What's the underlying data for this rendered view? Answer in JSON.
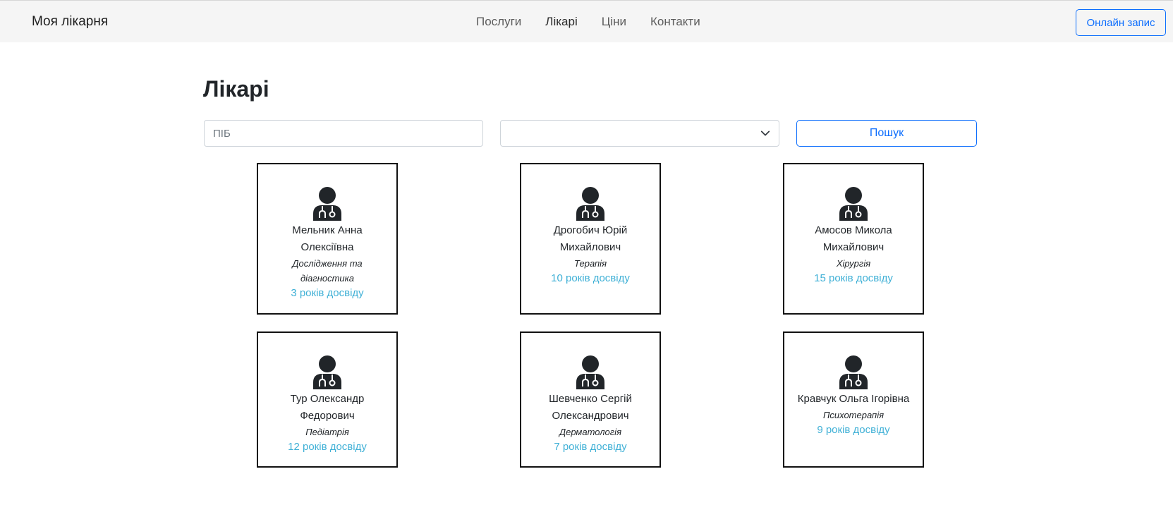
{
  "header": {
    "brand": "Моя лікарня",
    "nav": [
      {
        "label": "Послуги",
        "active": false
      },
      {
        "label": "Лікарі",
        "active": true
      },
      {
        "label": "Ціни",
        "active": false
      },
      {
        "label": "Контакти",
        "active": false
      }
    ],
    "cta_label": "Онлайн запис"
  },
  "page": {
    "title": "Лікарі"
  },
  "filters": {
    "name_placeholder": "ПІБ",
    "name_value": "",
    "specialty_selected": "",
    "search_label": "Пошук"
  },
  "doctors": [
    {
      "name": "Мельник Анна Олексіївна",
      "specialty": "Дослідження та діагностика",
      "experience": "3 років досвіду"
    },
    {
      "name": "Дрогобич Юрій Михайлович",
      "specialty": "Терапія",
      "experience": "10 років досвіду"
    },
    {
      "name": "Амосов Микола Михайлович",
      "specialty": "Хірургія",
      "experience": "15 років досвіду"
    },
    {
      "name": "Тур Олександр Федорович",
      "specialty": "Педіатрія",
      "experience": "12 років досвіду"
    },
    {
      "name": "Шевченко Сергій Олександрович",
      "specialty": "Дерматологія",
      "experience": "7 років досвіду"
    },
    {
      "name": "Кравчук Ольга Ігорівна",
      "specialty": "Психотерапія",
      "experience": "9 років досвіду"
    }
  ],
  "colors": {
    "accent": "#0d6efd",
    "experience": "#3fb0d6",
    "navbar_bg": "#f5f5f5"
  },
  "icons": {
    "doctor": "user-doctor-icon",
    "select": "chevron-down-icon"
  }
}
